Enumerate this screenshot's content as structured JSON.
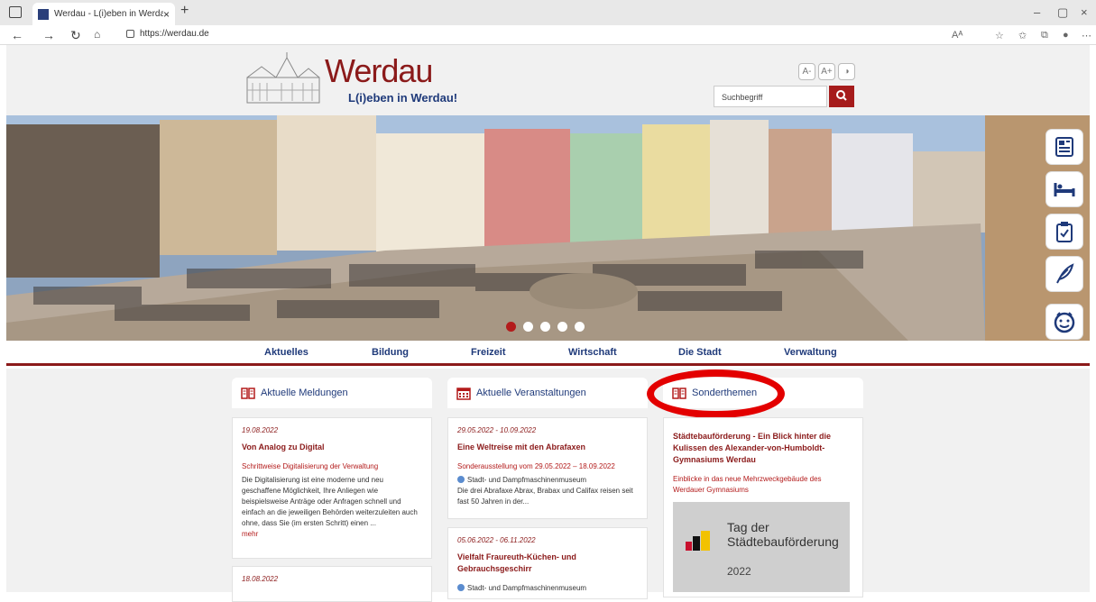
{
  "browser": {
    "tab_title": "Werdau - L(i)eben in Werdau",
    "tab_close": "×",
    "new_tab": "+",
    "url": "https://werdau.de",
    "min": "–",
    "restore": "▢",
    "close": "×"
  },
  "header": {
    "title": "Werdau",
    "subtitle": "L(i)eben in Werdau!",
    "font_smaller": "A-",
    "font_larger": "A+",
    "search_placeholder": "Suchbegriff"
  },
  "menu": [
    "Aktuelles",
    "Bildung",
    "Freizeit",
    "Wirtschaft",
    "Die Stadt",
    "Verwaltung"
  ],
  "columns": {
    "news": "Aktuelle Meldungen",
    "events": "Aktuelle Veranstaltungen",
    "special": "Sonderthemen"
  },
  "news": [
    {
      "date": "19.08.2022",
      "title": "Von Analog zu Digital",
      "subtitle": "Schrittweise Digitalisierung der Verwaltung",
      "text": "Die Digitalisierung ist eine moderne und neu geschaffene Möglichkeit, Ihre Anliegen wie beispielsweise Anträge oder Anfragen schnell und einfach an die jeweiligen Behörden weiterzuleiten auch ohne, dass Sie (im ersten Schritt) einen ...",
      "more": "mehr"
    },
    {
      "date": "18.08.2022"
    }
  ],
  "events": [
    {
      "date": "29.05.2022 - 10.09.2022",
      "title": "Eine Weltreise mit den Abrafaxen",
      "subtitle": "Sonderausstellung vom 29.05.2022 – 18.09.2022",
      "location": "Stadt- und Dampfmaschinenmuseum",
      "text": "Die drei Abrafaxe Abrax, Brabax und Califax reisen seit fast 50 Jahren in der..."
    },
    {
      "date": "05.06.2022 - 06.11.2022",
      "title": "Vielfalt Fraureuth-Küchen- und Gebrauchsgeschirr",
      "location": "Stadt- und Dampfmaschinenmuseum"
    }
  ],
  "special": {
    "title": "Städtebauförderung - Ein Blick hinter die Kulissen des Alexander-von-Humboldt-Gymnasiums Werdau",
    "subtitle": "Einblicke in das neue Mehrzweckgebäude des Werdauer Gymnasiums",
    "promo_line1": "Tag der",
    "promo_line2": "Städtebauförderung",
    "promo_year": "2022"
  },
  "colors": {
    "brand_red": "#8b1a1a",
    "brand_blue": "#1f3a7a",
    "highlight": "#e30000"
  }
}
